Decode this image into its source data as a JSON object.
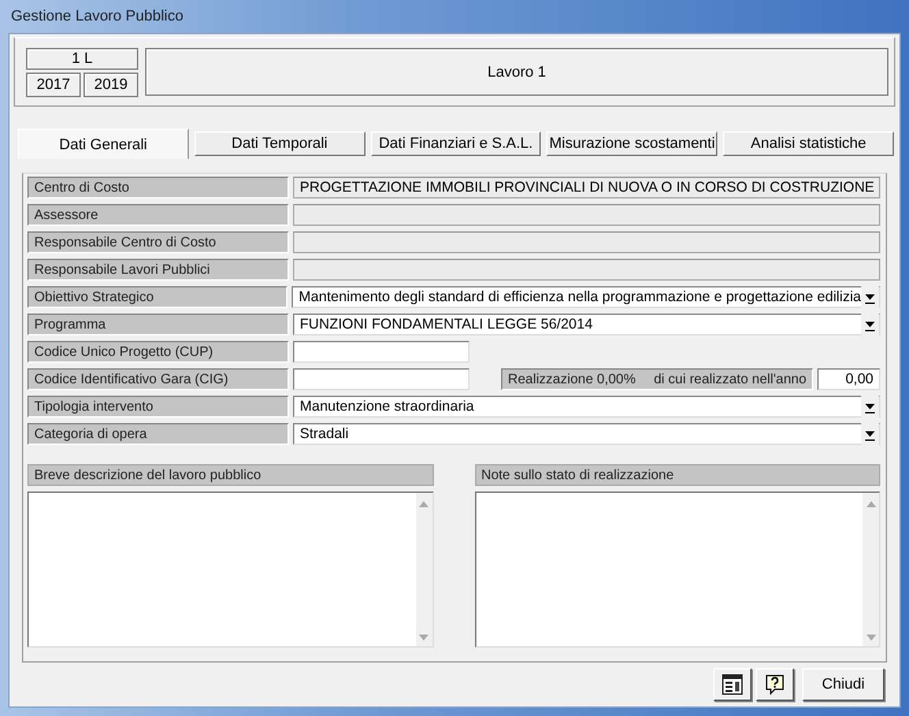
{
  "window": {
    "title": "Gestione Lavoro Pubblico"
  },
  "header": {
    "code": "1 L",
    "year_start": "2017",
    "year_end": "2019",
    "name": "Lavoro 1"
  },
  "tabs": [
    {
      "label": "Dati Generali",
      "selected": true
    },
    {
      "label": "Dati Temporali",
      "selected": false
    },
    {
      "label": "Dati Finanziari e S.A.L.",
      "selected": false
    },
    {
      "label": "Misurazione scostamenti",
      "selected": false
    },
    {
      "label": "Analisi statistiche",
      "selected": false
    }
  ],
  "fields": [
    {
      "label": "Centro di Costo",
      "kind": "readonly",
      "value": "PROGETTAZIONE IMMOBILI PROVINCIALI DI NUOVA O IN CORSO DI COSTRUZIONE"
    },
    {
      "label": "Assessore",
      "kind": "readonly"
    },
    {
      "label": "Responsabile Centro di Costo",
      "kind": "readonly"
    },
    {
      "label": "Responsabile Lavori Pubblici",
      "kind": "readonly"
    },
    {
      "label": "Obiettivo Strategico",
      "kind": "combo",
      "value": "Mantenimento degli standard di efficienza nella programmazione e progettazione edilizia"
    },
    {
      "label": "Programma",
      "kind": "combo",
      "value": "FUNZIONI FONDAMENTALI LEGGE 56/2014"
    },
    {
      "label": "Codice Unico Progetto (CUP)",
      "kind": "input"
    },
    {
      "label": "Codice Identificativo Gara (CIG)",
      "kind": "input",
      "realizzazione": "Realizzazione 0,00%",
      "realizzato_label": "di cui realizzato nell'anno",
      "realizzato_value": "0,00"
    },
    {
      "label": "Tipologia intervento",
      "kind": "combo",
      "value": "Manutenzione straordinaria"
    },
    {
      "label": "Categoria di opera",
      "kind": "combo",
      "value": "Stradali"
    }
  ],
  "notes": [
    {
      "label": "Breve descrizione del lavoro pubblico"
    },
    {
      "label": "Note sullo stato di realizzazione"
    }
  ],
  "buttons": [
    {
      "kind": "report"
    },
    {
      "kind": "help"
    },
    {
      "kind": "text",
      "label": "Chiudi"
    }
  ]
}
